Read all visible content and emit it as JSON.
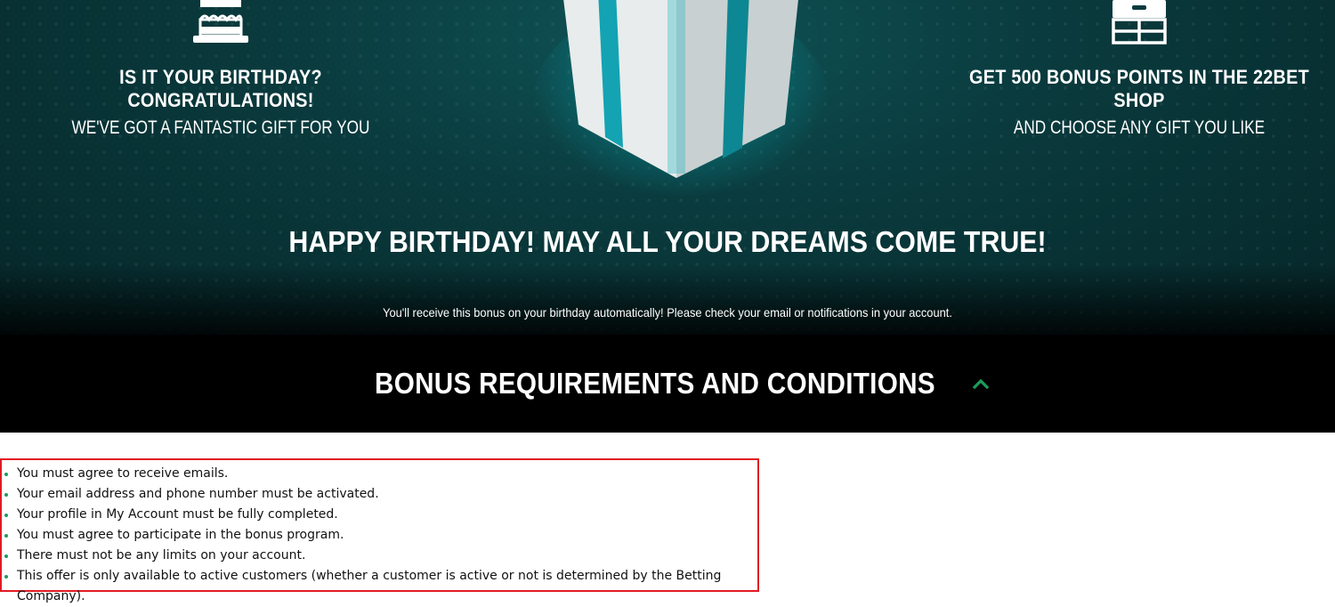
{
  "hero": {
    "left": {
      "icon": "birthday-cake-icon",
      "title": "IS IT YOUR BIRTHDAY? CONGRATULATIONS!",
      "subtitle": "WE'VE GOT A FANTASTIC GIFT FOR YOU"
    },
    "right": {
      "icon": "gift-shop-box-icon",
      "title": "GET 500 BONUS POINTS IN THE 22BET SHOP",
      "subtitle": "AND CHOOSE ANY GIFT YOU LIKE"
    },
    "center_icon": "gift-box-icon",
    "headline": "HAPPY BIRTHDAY! MAY ALL YOUR DREAMS COME TRUE!",
    "subtext": "You'll receive this bonus on your birthday automatically! Please check your email or notifications in your account."
  },
  "conditions": {
    "title": "BONUS REQUIREMENTS AND CONDITIONS",
    "toggle_icon": "chevron-up-icon",
    "accent_color": "#1e9c5a",
    "items": [
      "You must agree to receive emails.",
      "Your email address and phone number must be activated.",
      "Your profile in My Account must be fully completed.",
      "You must agree to participate in the bonus program.",
      "There must not be any limits on your account.",
      "This offer is only available to active customers (whether a customer is active or not is determined by the Betting Company)."
    ]
  },
  "colors": {
    "hero_bg": "#0a3b3e",
    "band_bg": "#000000",
    "highlight_border": "#e01b22",
    "gift_ribbon": "#13a3b3"
  }
}
